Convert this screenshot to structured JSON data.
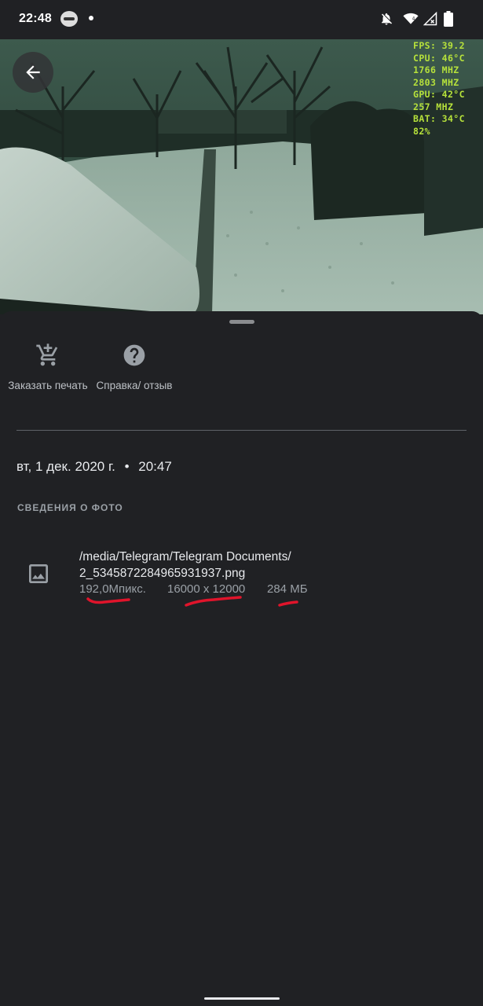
{
  "status_bar": {
    "time": "22:48",
    "icons": [
      "app-notification-icon",
      "dot-icon",
      "bell-off-icon",
      "wifi-icon",
      "signal-icon",
      "battery-icon"
    ]
  },
  "overlay": {
    "fps": "FPS: 39.2",
    "cpu": "CPU: 46°C",
    "cpu_freq": "1766 MHZ",
    "mem_freq": "2803 MHZ",
    "gpu": "GPU: 42°C",
    "gpu_freq": "257 MHZ",
    "bat": "BAT: 34°C",
    "bat_level": "82%"
  },
  "actions": [
    {
      "label": "Заказать печать",
      "icon": "cart-icon"
    },
    {
      "label": "Справка/ отзыв",
      "icon": "help-icon"
    }
  ],
  "date": "вт, 1 дек. 2020 г.",
  "separator": "•",
  "time_taken": "20:47",
  "section_title": "СВЕДЕНИЯ О ФОТО",
  "file": {
    "path_line1": "/media/Telegram/Telegram Documents/",
    "path_line2": "2_5345872284965931937.png",
    "megapixels": "192,0Мпикс.",
    "resolution": "16000 x 12000",
    "size": "284 МБ"
  },
  "colors": {
    "background": "#202124",
    "overlay_text": "#b7e23b",
    "annotation": "#e0142b"
  }
}
